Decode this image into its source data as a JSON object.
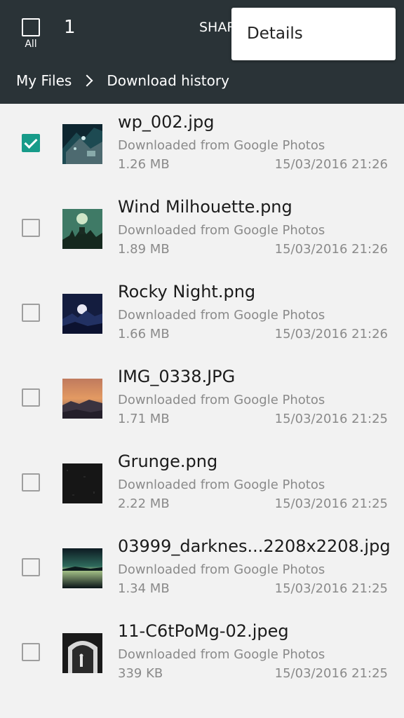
{
  "header": {
    "select_all_label": "All",
    "selected_count": "1",
    "share_label": "SHARE",
    "menu": {
      "details_label": "Details"
    },
    "breadcrumb": {
      "root": "My Files",
      "current": "Download history"
    }
  },
  "colors": {
    "header_bg": "#2a3337",
    "accent": "#179b89",
    "list_bg": "#f2f2f2"
  },
  "files": [
    {
      "name": "wp_002.jpg",
      "source": "Downloaded from Google Photos",
      "size": "1.26 MB",
      "date": "15/03/2016 21:26",
      "checked": true,
      "thumbnail": "space-scene-thumbnail"
    },
    {
      "name": "Wind Milhouette.png",
      "source": "Downloaded from Google Photos",
      "size": "1.89 MB",
      "date": "15/03/2016 21:26",
      "checked": false,
      "thumbnail": "green-landscape-thumbnail"
    },
    {
      "name": "Rocky Night.png",
      "source": "Downloaded from Google Photos",
      "size": "1.66 MB",
      "date": "15/03/2016 21:26",
      "checked": false,
      "thumbnail": "night-mountain-thumbnail"
    },
    {
      "name": "IMG_0338.JPG",
      "source": "Downloaded from Google Photos",
      "size": "1.71 MB",
      "date": "15/03/2016 21:25",
      "checked": false,
      "thumbnail": "sunset-thumbnail"
    },
    {
      "name": "Grunge.png",
      "source": "Downloaded from Google Photos",
      "size": "2.22 MB",
      "date": "15/03/2016 21:25",
      "checked": false,
      "thumbnail": "dark-texture-thumbnail"
    },
    {
      "name": "03999_darknes...2208x2208.jpg",
      "source": "Downloaded from Google Photos",
      "size": "1.34 MB",
      "date": "15/03/2016 21:25",
      "checked": false,
      "thumbnail": "dusk-lake-thumbnail"
    },
    {
      "name": "11-C6tPoMg-02.jpeg",
      "source": "Downloaded from Google Photos",
      "size": "339 KB",
      "date": "15/03/2016 21:25",
      "checked": false,
      "thumbnail": "monochrome-thumbnail"
    }
  ]
}
